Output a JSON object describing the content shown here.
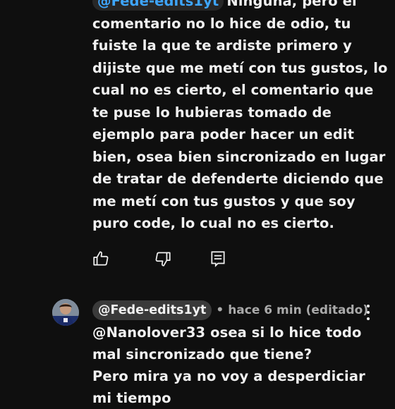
{
  "top_comment": {
    "mention": "@Fede-edits1yt",
    "text": "Ninguna, pero el comentario no lo hice de odio, tu fuiste la que te ardiste primero y dijiste que me metí con tus gustos, lo cual no es cierto, el comentario que te puse lo hubieras tomado de ejemplo para poder hacer un edit bien, osea bien sincronizado en lugar de tratar de defenderte diciendo que me metí con tus gustos y que soy puro code, lo cual no es cierto.",
    "actions": {
      "like_icon": "thumbs-up-icon",
      "dislike_icon": "thumbs-down-icon",
      "reply_icon": "reply-comment-icon"
    }
  },
  "reply_comment": {
    "author": "@Fede-edits1yt",
    "meta": "• hace 6 min (editado)",
    "lines": [
      "@Nanolover33 osea si lo hice todo mal sincronizado que tiene?",
      "Pero mira ya no voy a desperdiciar mi tiempo"
    ],
    "menu_icon": "more-vert-icon"
  },
  "colors": {
    "background": "#0f0f0f",
    "text": "#f1f1f1",
    "mention_link": "#3ea6ff",
    "meta_gray": "#aaaaaa",
    "chip_bg": "#3a3a3a"
  }
}
